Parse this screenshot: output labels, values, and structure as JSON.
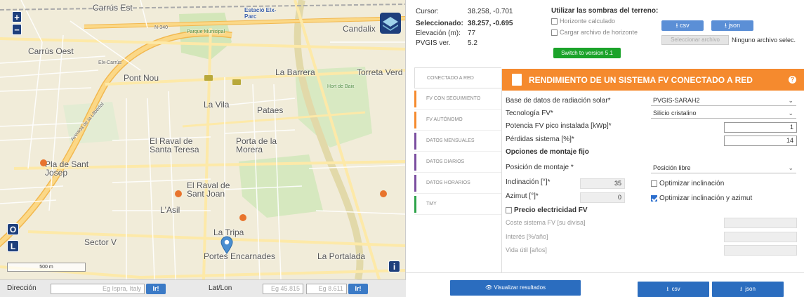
{
  "map": {
    "zoom_in": "+",
    "zoom_out": "−",
    "btn_o": "O",
    "btn_l": "L",
    "btn_i": "i",
    "scale": "500 m",
    "labels": [
      {
        "name": "Carrús Est",
        "cls": "big"
      },
      {
        "name": "Carrús Oest",
        "cls": "big"
      },
      {
        "name": "Estació Elx-Parc",
        "cls": "station"
      },
      {
        "name": "Candalix",
        "cls": "big"
      },
      {
        "name": "Pont Nou",
        "cls": "big"
      },
      {
        "name": "La Barrera",
        "cls": "big"
      },
      {
        "name": "Torreta Verd",
        "cls": "big"
      },
      {
        "name": "La Vila",
        "cls": "big"
      },
      {
        "name": "Pla de Sant Josep",
        "cls": "big"
      },
      {
        "name": "El Raval de Santa Teresa",
        "cls": "big"
      },
      {
        "name": "Porta de la Morera",
        "cls": "big"
      },
      {
        "name": "Pataes",
        "cls": "big"
      },
      {
        "name": "El Raval de Sant Joan",
        "cls": "big"
      },
      {
        "name": "L'Asil",
        "cls": "big"
      },
      {
        "name": "La Tripa",
        "cls": "big"
      },
      {
        "name": "Sector V",
        "cls": "big"
      },
      {
        "name": "Portes Encarnades",
        "cls": "big"
      },
      {
        "name": "La Portalada",
        "cls": "big"
      },
      {
        "name": "Avenida de la Llibertat",
        "cls": "small"
      },
      {
        "name": "N-340",
        "cls": "small"
      },
      {
        "name": "Elx-Carrús",
        "cls": "small"
      },
      {
        "name": "Parque Municipal",
        "cls": "green"
      },
      {
        "name": "Hort de Baix",
        "cls": "green"
      }
    ]
  },
  "address": {
    "direccion_label": "Dirección",
    "direccion_placeholder": "Eg Ispra, Italy",
    "go_label": "Ir!",
    "latlon_label": "Lat/Lon",
    "lat_placeholder": "Eg 45.815",
    "lon_placeholder": "Eg 8.611",
    "go2_label": "Ir!"
  },
  "info": {
    "cursor_label": "Cursor:",
    "cursor_value": "38.258, -0.701",
    "selected_label": "Seleccionado:",
    "selected_value": "38.257, -0.695",
    "elevation_label": "Elevación (m):",
    "elevation_value": "77",
    "pvgis_label": "PVGIS ver.",
    "pvgis_value": "5.2"
  },
  "shading": {
    "title": "Utilizar las sombras del terreno:",
    "horizon_calc": "Horizonte calculado",
    "horizon_file": "Cargar archivo de horizonte",
    "csv": "csv",
    "json": "json",
    "file_btn": "Seleccionar archivo",
    "file_none": "Ninguno archivo selec.",
    "switch": "Switch to version 5.1"
  },
  "tabs": [
    {
      "label": "Conectado a red",
      "color": "#f58a2e"
    },
    {
      "label": "FV con seguimiento",
      "color": "#f58a2e"
    },
    {
      "label": "FV autónomo",
      "color": "#f58a2e"
    },
    {
      "label": "Datos mensuales",
      "color": "#7b4ea0"
    },
    {
      "label": "Datos diarios",
      "color": "#7b4ea0"
    },
    {
      "label": "Datos horarios",
      "color": "#7b4ea0"
    },
    {
      "label": "TMY",
      "color": "#2da34a"
    }
  ],
  "panel": {
    "title": "RENDIMIENTO DE UN SISTEMA FV CONECTADO A RED",
    "help": "?",
    "db_label": "Base de datos de radiación solar*",
    "db_value": "PVGIS-SARAH2",
    "tech_label": "Tecnología FV*",
    "tech_value": "Silicio cristalino",
    "power_label": "Potencia FV pico instalada [kWp]*",
    "power_value": "1",
    "loss_label": "Pérdidas sistema [%]*",
    "loss_value": "14",
    "mount_title": "Opciones de montaje fijo",
    "mount_label": "Posición de montaje *",
    "mount_value": "Posición libre",
    "incl_label": "Inclinación [°]*",
    "incl_value": "35",
    "opt_incl": "Optimizar inclinación",
    "azim_label": "Azimut [°]*",
    "azim_value": "0",
    "opt_azim": "Optimizar inclinación y azimut",
    "price_label": "Precio electricidad FV",
    "cost_label": "Coste sistema FV [su divisa]",
    "interest_label": "Interés [%/año]",
    "life_label": "Vida útil [años]"
  },
  "bottom": {
    "visualize": "Visualizar resultados",
    "csv": "csv",
    "json": "json"
  }
}
